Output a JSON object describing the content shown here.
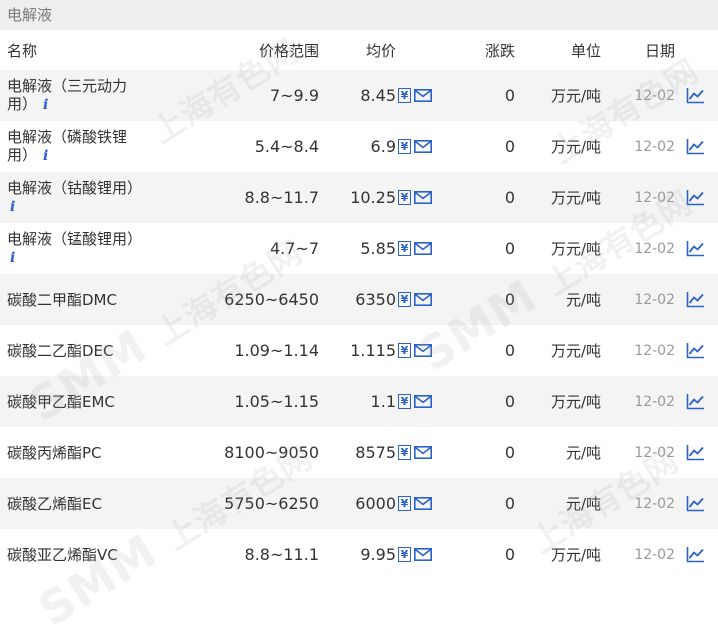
{
  "title": "电解液",
  "headers": {
    "name": "名称",
    "range": "价格范围",
    "avg": "均价",
    "change": "涨跌",
    "unit": "单位",
    "date": "日期"
  },
  "rows": [
    {
      "name": "电解液（三元动力用）",
      "range": "7~9.9",
      "avg": "8.45",
      "change": "0",
      "unit": "万元/吨",
      "date": "12-02"
    },
    {
      "name": "电解液（磷酸铁锂用）",
      "range": "5.4~8.4",
      "avg": "6.9",
      "change": "0",
      "unit": "万元/吨",
      "date": "12-02"
    },
    {
      "name": "电解液（钴酸锂用）",
      "range": "8.8~11.7",
      "avg": "10.25",
      "change": "0",
      "unit": "万元/吨",
      "date": "12-02"
    },
    {
      "name": "电解液（锰酸锂用）",
      "range": "4.7~7",
      "avg": "5.85",
      "change": "0",
      "unit": "万元/吨",
      "date": "12-02"
    },
    {
      "name": "碳酸二甲酯DMC",
      "range": "6250~6450",
      "avg": "6350",
      "change": "0",
      "unit": "元/吨",
      "date": "12-02"
    },
    {
      "name": "碳酸二乙酯DEC",
      "range": "1.09~1.14",
      "avg": "1.115",
      "change": "0",
      "unit": "万元/吨",
      "date": "12-02"
    },
    {
      "name": "碳酸甲乙酯EMC",
      "range": "1.05~1.15",
      "avg": "1.1",
      "change": "0",
      "unit": "万元/吨",
      "date": "12-02"
    },
    {
      "name": "碳酸丙烯酯PC",
      "range": "8100~9050",
      "avg": "8575",
      "change": "0",
      "unit": "元/吨",
      "date": "12-02"
    },
    {
      "name": "碳酸乙烯酯EC",
      "range": "5750~6250",
      "avg": "6000",
      "change": "0",
      "unit": "元/吨",
      "date": "12-02"
    },
    {
      "name": "碳酸亚乙烯酯VC",
      "range": "8.8~11.1",
      "avg": "9.95",
      "change": "0",
      "unit": "万元/吨",
      "date": "12-02"
    }
  ],
  "icons": {
    "info": "info-icon",
    "yen": "yen-icon",
    "mail": "mail-icon",
    "trend": "trend-chart-icon"
  },
  "colors": {
    "accent": "#2a62c9",
    "title_bg": "#eeeeee",
    "row_alt_bg": "#f4f4f4",
    "date_text": "#9a9a9a"
  },
  "watermark": {
    "logo": "SMM",
    "text": "上海有色网"
  }
}
